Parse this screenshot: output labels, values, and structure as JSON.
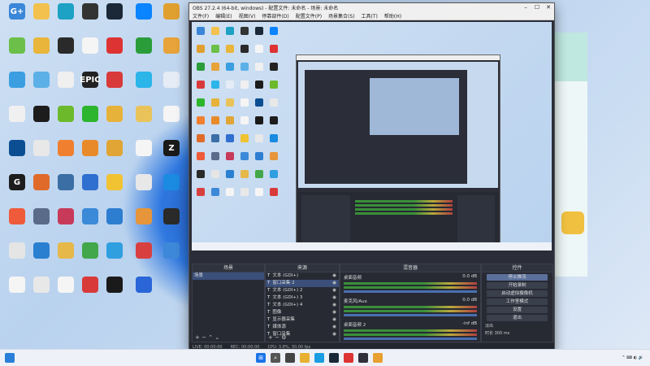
{
  "desktop": {
    "icons": [
      {
        "label": "",
        "color": "#3a86d8",
        "glyph": "G+"
      },
      {
        "label": "",
        "color": "#f2c14e",
        "glyph": ""
      },
      {
        "label": "",
        "color": "#1da1c4",
        "glyph": ""
      },
      {
        "label": "",
        "color": "#333",
        "glyph": ""
      },
      {
        "label": "",
        "color": "#1b2838",
        "glyph": ""
      },
      {
        "label": "",
        "color": "#0a84ff",
        "glyph": ""
      },
      {
        "label": "",
        "color": "#e0a030",
        "glyph": ""
      },
      {
        "label": "",
        "color": "#6cc04a",
        "glyph": ""
      },
      {
        "label": "",
        "color": "#e9b53a",
        "glyph": ""
      },
      {
        "label": "",
        "color": "#2a2a2a",
        "glyph": ""
      },
      {
        "label": "",
        "color": "#f5f5f5",
        "glyph": ""
      },
      {
        "label": "",
        "color": "#d33",
        "glyph": ""
      },
      {
        "label": "",
        "color": "#2a9d3a",
        "glyph": ""
      },
      {
        "label": "",
        "color": "#e8a33a",
        "glyph": ""
      },
      {
        "label": "",
        "color": "#3a9ee0",
        "glyph": ""
      },
      {
        "label": "",
        "color": "#5bb0e8",
        "glyph": ""
      },
      {
        "label": "",
        "color": "#f0f0f0",
        "glyph": ""
      },
      {
        "label": "",
        "color": "#222",
        "glyph": "EPIC"
      },
      {
        "label": "",
        "color": "#d83a3a",
        "glyph": ""
      },
      {
        "label": "",
        "color": "#2bb5e8",
        "glyph": ""
      },
      {
        "label": "",
        "color": "#e5ecf5",
        "glyph": ""
      },
      {
        "label": "",
        "color": "#f0f0f0",
        "glyph": ""
      },
      {
        "label": "",
        "color": "#1c1c1c",
        "glyph": ""
      },
      {
        "label": "",
        "color": "#6cba2b",
        "glyph": ""
      },
      {
        "label": "",
        "color": "#2db52d",
        "glyph": ""
      },
      {
        "label": "",
        "color": "#e7b23a",
        "glyph": ""
      },
      {
        "label": "",
        "color": "#e9c35a",
        "glyph": ""
      },
      {
        "label": "",
        "color": "#f5f5f5",
        "glyph": ""
      },
      {
        "label": "",
        "color": "#0c4e92",
        "glyph": ""
      },
      {
        "label": "",
        "color": "#e8e8e8",
        "glyph": ""
      },
      {
        "label": "",
        "color": "#f08030",
        "glyph": ""
      },
      {
        "label": "",
        "color": "#e98a2a",
        "glyph": ""
      },
      {
        "label": "",
        "color": "#e0a534",
        "glyph": ""
      },
      {
        "label": "",
        "color": "#f5f5f5",
        "glyph": ""
      },
      {
        "label": "",
        "color": "#1a1a1a",
        "glyph": "Z"
      },
      {
        "label": "",
        "color": "#1d1d1d",
        "glyph": "G"
      },
      {
        "label": "",
        "color": "#e06a2a",
        "glyph": ""
      },
      {
        "label": "",
        "color": "#3a6ea5",
        "glyph": ""
      },
      {
        "label": "",
        "color": "#2f6fd0",
        "glyph": ""
      },
      {
        "label": "",
        "color": "#f1c232",
        "glyph": ""
      },
      {
        "label": "",
        "color": "#e8e8e8",
        "glyph": ""
      },
      {
        "label": "",
        "color": "#1a8be0",
        "glyph": ""
      },
      {
        "label": "",
        "color": "#ee5a3a",
        "glyph": ""
      },
      {
        "label": "",
        "color": "#5a6b8a",
        "glyph": ""
      },
      {
        "label": "",
        "color": "#c83a5a",
        "glyph": ""
      },
      {
        "label": "",
        "color": "#3a8ad8",
        "glyph": ""
      },
      {
        "label": "",
        "color": "#2d7ed0",
        "glyph": ""
      },
      {
        "label": "",
        "color": "#e6953a",
        "glyph": ""
      },
      {
        "label": "",
        "color": "#2a2a2a",
        "glyph": ""
      },
      {
        "label": "",
        "color": "#e5e5e5",
        "glyph": ""
      },
      {
        "label": "",
        "color": "#2a7fd0",
        "glyph": ""
      },
      {
        "label": "",
        "color": "#e6b84a",
        "glyph": ""
      },
      {
        "label": "",
        "color": "#42a74a",
        "glyph": ""
      },
      {
        "label": "",
        "color": "#2f9fe0",
        "glyph": ""
      },
      {
        "label": "",
        "color": "#d84040",
        "glyph": ""
      },
      {
        "label": "",
        "color": "#3d88d8",
        "glyph": ""
      },
      {
        "label": "",
        "color": "#f5f5f5",
        "glyph": ""
      },
      {
        "label": "",
        "color": "#e8e8e8",
        "glyph": ""
      },
      {
        "label": "",
        "color": "#f5f5f5",
        "glyph": ""
      },
      {
        "label": "",
        "color": "#d83a3a",
        "glyph": ""
      },
      {
        "label": "",
        "color": "#1a1a1a",
        "glyph": ""
      },
      {
        "label": "",
        "color": "#2a66d8",
        "glyph": ""
      }
    ],
    "taskbar_time": "",
    "taskbar_date": ""
  },
  "obs": {
    "title": "OBS 27.2.4 (64-bit, windows) - 配置文件: 未命名 - 场景: 未命名",
    "menu": [
      "文件(F)",
      "编辑(E)",
      "视图(V)",
      "停靠部件(D)",
      "配置文件(P)",
      "场景集合(S)",
      "工具(T)",
      "帮助(H)"
    ],
    "scene_label": "未命名",
    "panels": {
      "scenes": "场景",
      "sources": "来源",
      "mixer": "混音器",
      "controls": "控件"
    },
    "scene_items": [
      "场景"
    ],
    "source_items": [
      "文本 (GDI+)",
      "窗口采集 2",
      "文本 (GDI+) 2",
      "文本 (GDI+) 3",
      "文本 (GDI+) 4",
      "图像",
      "显示器采集",
      "媒体源",
      "窗口采集"
    ],
    "mixer_tracks": [
      {
        "name": "桌面音频",
        "value": "0.0 dB"
      },
      {
        "name": "麦克风/Aux",
        "value": "0.0 dB"
      },
      {
        "name": "桌面音频 2",
        "value": "-inf dB"
      }
    ],
    "control_buttons": [
      "停止推流",
      "开始录制",
      "启动虚拟摄像机",
      "工作室模式",
      "设置",
      "退出"
    ],
    "transition_label": "场景转场",
    "transition_type": "淡出",
    "duration_label": "时长",
    "duration_value": "300 ms",
    "status": {
      "live": "LIVE: 00:00:00",
      "rec": "REC: 00:00:00",
      "cpu": "CPU: 3.8%, 30.00 fps"
    }
  }
}
